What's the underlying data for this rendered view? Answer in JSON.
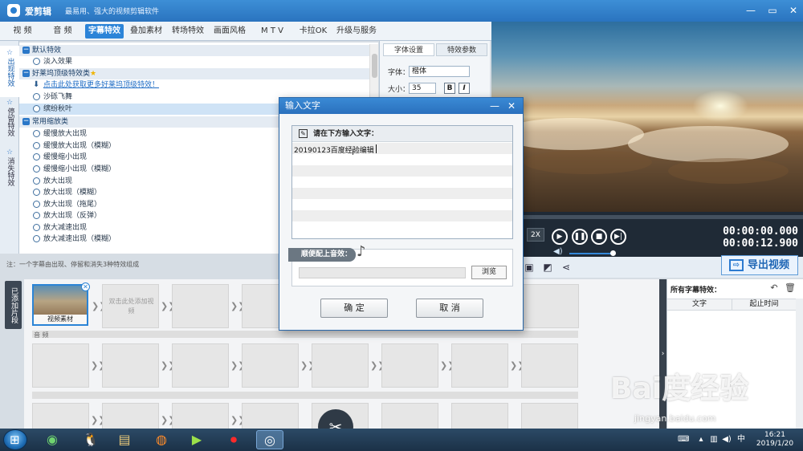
{
  "app": {
    "title": "爱剪辑",
    "slogan": "最易用、强大的视频剪辑软件",
    "window_controls": [
      "—",
      "▭",
      "✕"
    ]
  },
  "menu": [
    {
      "label": "视 频",
      "active": false
    },
    {
      "label": "音 频",
      "active": false
    },
    {
      "label": "字幕特效",
      "active": true
    },
    {
      "label": "叠加素材",
      "active": false
    },
    {
      "label": "转场特效",
      "active": false
    },
    {
      "label": "画面风格",
      "active": false
    },
    {
      "label": "M T V",
      "active": false
    },
    {
      "label": "卡拉OK",
      "active": false
    },
    {
      "label": "升级与服务",
      "active": false
    }
  ],
  "side_tabs": [
    {
      "label": "出现特效",
      "active": true
    },
    {
      "label": "停留特效",
      "active": false
    },
    {
      "label": "消失特效",
      "active": false
    }
  ],
  "effects": {
    "groups": [
      {
        "title": "默认特效",
        "items": [
          "淡入效果"
        ]
      },
      {
        "title": "好莱坞顶级特效类",
        "star": "★",
        "download_link": "点击此处获取更多好莱坞顶级特效！",
        "items": [
          "沙砾飞舞",
          "缤纷秋叶"
        ]
      },
      {
        "title": "常用缩放类",
        "items": [
          "缓慢放大出现",
          "缓慢放大出现（模糊）",
          "缓慢缩小出现",
          "缓慢缩小出现（模糊）",
          "放大出现",
          "放大出现（模糊）",
          "放大出现（拖尾）",
          "放大出现（反弹）",
          "放大减速出现",
          "放大减速出现（模糊）"
        ]
      }
    ],
    "selected": "缤纷秋叶",
    "note": "注：一个字幕由出现、停留和消失3种特效组成"
  },
  "settings": {
    "tabs": [
      "字体设置",
      "特效参数"
    ],
    "font_label": "字体：",
    "font_value": "楷体",
    "size_label": "大小：",
    "size_value": "35",
    "bold": "B",
    "italic": "I"
  },
  "player": {
    "speed": "2X",
    "current_time": "00:00:00.000",
    "total_time": "00:00:12.900",
    "progress": 0.0,
    "volume": 0.75
  },
  "export": {
    "label": "导出视频"
  },
  "timeline": {
    "added_label": "已添加片段",
    "clip_label": "视频素材",
    "add_hint": "双击此处添加视频",
    "audio_label": "音 频"
  },
  "subtitles_panel": {
    "title": "所有字幕特效：",
    "columns": [
      "文字",
      "起止时间"
    ]
  },
  "dialog": {
    "title": "输入文字",
    "prompt": "请在下方输入文字：",
    "text_value": "20190123百度经验编辑",
    "sound_label": "顺便配上音效：",
    "browse": "浏览",
    "ok": "确 定",
    "cancel": "取 消"
  },
  "taskbar": {
    "time": "16:21",
    "date": "2019/1/20"
  },
  "watermark": {
    "main": "Bai度经验",
    "sub": "jingyan.baidu.com"
  }
}
